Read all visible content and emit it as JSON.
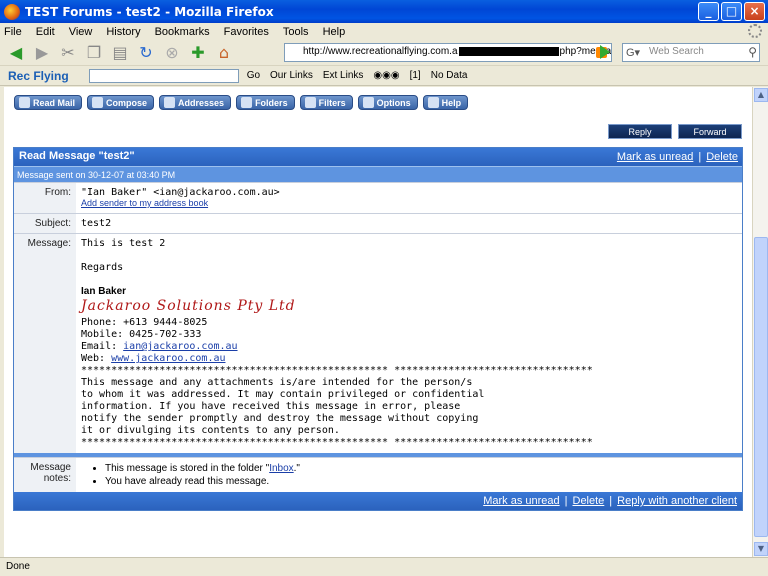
{
  "window": {
    "title": "TEST Forums - test2 - Mozilla Firefox"
  },
  "menu": [
    "File",
    "Edit",
    "View",
    "History",
    "Bookmarks",
    "Favorites",
    "Tools",
    "Help"
  ],
  "nav": {
    "url_start": "http://www.recreationalflying.com.a",
    "url_end": "php?messag",
    "search_placeholder": "Web Search"
  },
  "linkbar": {
    "brand": "Rec Flying",
    "go": "Go",
    "our_links": "Our Links",
    "ext_links": "Ext Links",
    "count": "[1]",
    "no_data": "No Data"
  },
  "mail_toolbar": [
    "Read Mail",
    "Compose",
    "Addresses",
    "Folders",
    "Filters",
    "Options",
    "Help"
  ],
  "actions": {
    "reply": "Reply",
    "forward": "Forward"
  },
  "message": {
    "header": "Read Message \"test2\"",
    "mark_unread": "Mark as unread",
    "delete": "Delete",
    "sent": "Message sent on 30-12-07 at 03:40 PM",
    "from_label": "From:",
    "from": "\"Ian Baker\" <ian@jackaroo.com.au>",
    "add_sender": "Add sender to my address book",
    "subject_label": "Subject:",
    "subject": "test2",
    "message_label": "Message:",
    "body_lines": "This is test 2\n\nRegards\n\n",
    "sig_name": "Ian Baker",
    "sig_company": "Jackaroo Solutions Pty Ltd",
    "phone": "Phone: +613 9444-8025",
    "mobile": "Mobile: 0425-702-333",
    "email_label": "Email: ",
    "email": "ian@jackaroo.com.au",
    "web_label": "Web: ",
    "web": "www.jackaroo.com.au",
    "disclaimer": "*************************************************** *********************************\nThis message and any attachments is/are intended for the person/s\nto whom it was addressed. It may contain privileged or confidential\ninformation. If you have received this message in error, please\nnotify the sender promptly and destroy the message without copying\nit or divulging its contents to any person.\n*************************************************** *********************************",
    "notes_label": "Message notes:",
    "note1_pre": "This message is stored in the folder \"",
    "note1_link": "Inbox",
    "note1_post": ".\"",
    "note2": "You have already read this message.",
    "reply_other": "Reply with another client"
  },
  "status": "Done"
}
